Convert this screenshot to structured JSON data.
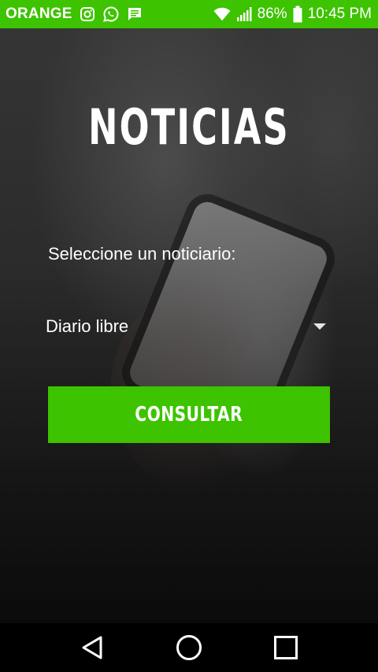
{
  "status_bar": {
    "carrier": "ORANGE",
    "icons": [
      "instagram-icon",
      "whatsapp-icon",
      "message-icon"
    ],
    "right_icons": [
      "wifi-icon",
      "signal-icon",
      "battery-icon"
    ],
    "battery_percent": "86%",
    "time": "10:45 PM",
    "color": "#3dc300"
  },
  "main": {
    "title": "NOTICIAS",
    "select_label": "Seleccione un noticiario:",
    "selected_newspaper": "Diario libre",
    "button_label": "CONSULTAR",
    "accent_color": "#3dc300"
  },
  "nav_bar": {
    "buttons": [
      "back-icon",
      "home-icon",
      "recents-icon"
    ]
  }
}
